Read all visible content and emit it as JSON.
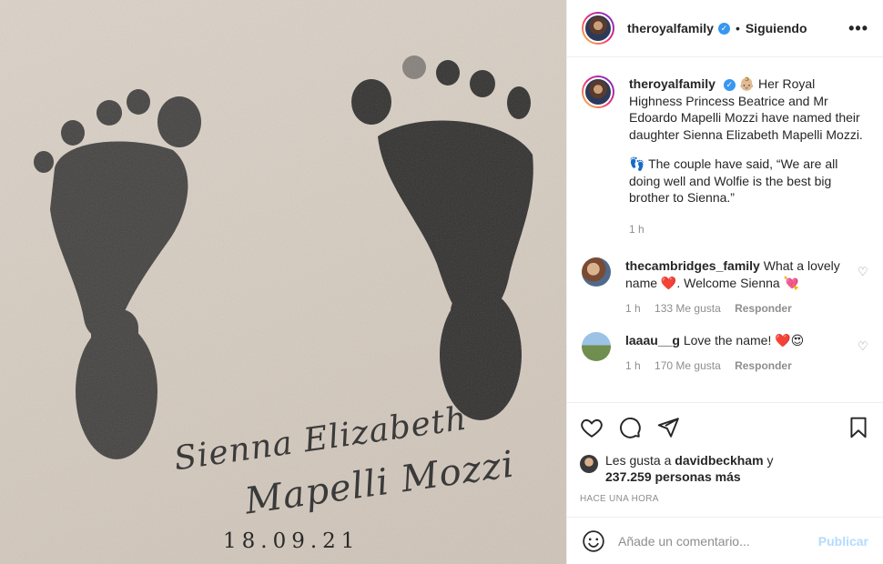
{
  "header": {
    "username": "theroyalfamily",
    "separator": "•",
    "follow_status": "Siguiendo",
    "more_label": "•••"
  },
  "image": {
    "script_line1": "Sienna Elizabeth",
    "script_line2": "Mapelli Mozzi",
    "date": "18.09.21"
  },
  "caption": {
    "username": "theroyalfamily",
    "text1": "👶🏼 Her Royal Highness Princess Beatrice and Mr Edoardo Mapelli Mozzi have named their daughter Sienna Elizabeth Mapelli Mozzi.",
    "text2": "👣 The couple have said, “We are all doing well and Wolfie is the best big brother to Sienna.”",
    "time": "1 h"
  },
  "comments": [
    {
      "username": "thecambridges_family",
      "text": "What a lovely name ❤️. Welcome Sienna 💘",
      "time": "1 h",
      "likes": "133 Me gusta",
      "reply": "Responder"
    },
    {
      "username": "laaau__g",
      "text": "Love the name! ❤️😍",
      "time": "1 h",
      "likes": "170 Me gusta",
      "reply": "Responder"
    }
  ],
  "likes": {
    "prefix": "Les gusta a",
    "user": "davidbeckham",
    "conj": "y",
    "count": "237.259 personas más"
  },
  "posted": "HACE UNA HORA",
  "comment_box": {
    "placeholder": "Añade un comentario...",
    "publish": "Publicar"
  },
  "colors": {
    "accent": "#3897f0",
    "publish_disabled": "#b3dbff",
    "muted": "#8e8e8e"
  }
}
